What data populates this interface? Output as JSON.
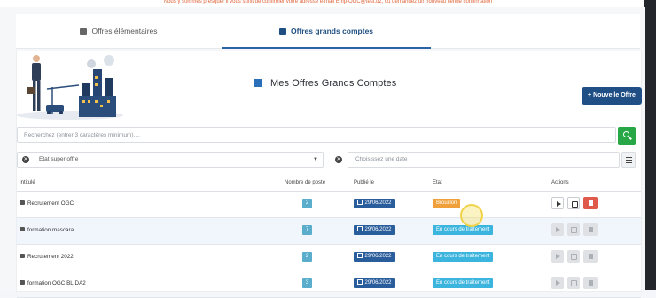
{
  "banner": {
    "text": "Nous y sommes presque! Il vous suffit de confirmer votre adresse e-mail Emp-OGC@test.dz, ou demandez un nouveau liende confirmation"
  },
  "tabs": [
    {
      "label": "Offres élémentaires",
      "icon": "briefcase-icon",
      "active": false
    },
    {
      "label": "Offres grands comptes",
      "icon": "briefcase-icon",
      "active": true
    }
  ],
  "main": {
    "title": "Mes Offres Grands Comptes",
    "new_button": "+ Nouvelle Offre",
    "search": {
      "placeholder": "Recherchez (entrer 3 caractères minimum)...."
    },
    "filter_state": {
      "value": "Etat super offre"
    },
    "filter_date": {
      "placeholder": "Choisissez une date"
    }
  },
  "table": {
    "headers": [
      "Intitulé",
      "Nombre de poste",
      "Publié le",
      "Etat",
      "Actions"
    ],
    "rows": [
      {
        "name": "Recrutement OGC",
        "count": "2",
        "date": "29/06/2022",
        "state": "Brouillon"
      },
      {
        "name": "formation mascara",
        "count": "7",
        "date": "29/06/2022",
        "state": "En cours de traitement"
      },
      {
        "name": "Recrutement 2022",
        "count": "2",
        "date": "29/06/2022",
        "state": "En cours de traitement"
      },
      {
        "name": "formation OGC BLIDA2",
        "count": "3",
        "date": "29/06/2022",
        "state": "En cours de traitement"
      }
    ]
  },
  "colors": {
    "primary": "#1f4f85",
    "brouillon": "#f0a03a",
    "en_cours": "#3bb4de",
    "search_button": "#27a745",
    "delete": "#e05a4b"
  }
}
